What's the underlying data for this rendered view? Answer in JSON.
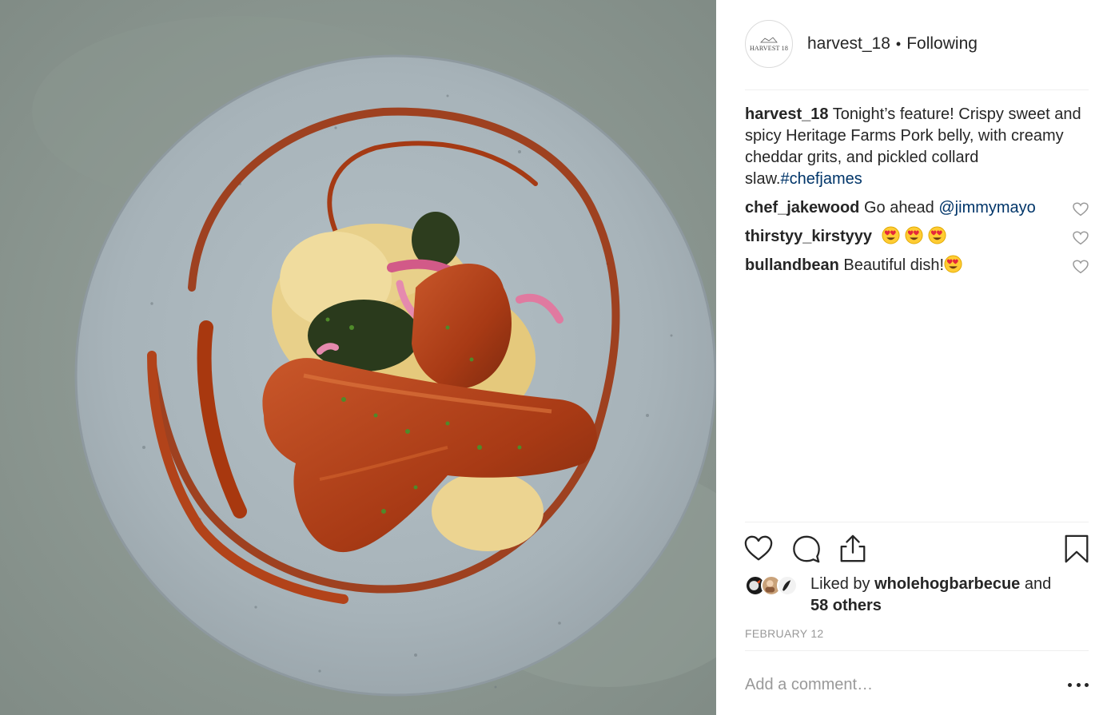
{
  "post": {
    "username": "harvest_18",
    "separator": "•",
    "follow_status": "Following",
    "avatar_text": "HARVEST 18"
  },
  "caption": {
    "username": "harvest_18",
    "text": "Tonight’s feature! Crispy sweet and spicy Heritage Farms Pork belly, with creamy cheddar grits, and pickled collard slaw.",
    "hashtag": "#chefjames"
  },
  "comments": [
    {
      "username": "chef_jakewood",
      "text": "Go ahead ",
      "mention": "@jimmymayo",
      "emoji_count": 0
    },
    {
      "username": "thirstyy_kirstyyy",
      "text": "",
      "mention": "",
      "emoji_count": 3
    },
    {
      "username": "bullandbean",
      "text": "Beautiful dish!",
      "mention": "",
      "emoji_count": 1
    }
  ],
  "likes": {
    "prefix": "Liked by ",
    "user": "wholehogbarbecue",
    "middle": " and",
    "others": "58 others"
  },
  "date": "FEBRUARY 12",
  "comment_input": {
    "placeholder": "Add a comment…"
  },
  "icons": [
    "heart-icon",
    "comment-icon",
    "share-icon",
    "bookmark-icon",
    "more-options-icon"
  ],
  "colors": {
    "text": "#262626",
    "link": "#003569",
    "muted": "#999999",
    "divider": "#efefef"
  }
}
